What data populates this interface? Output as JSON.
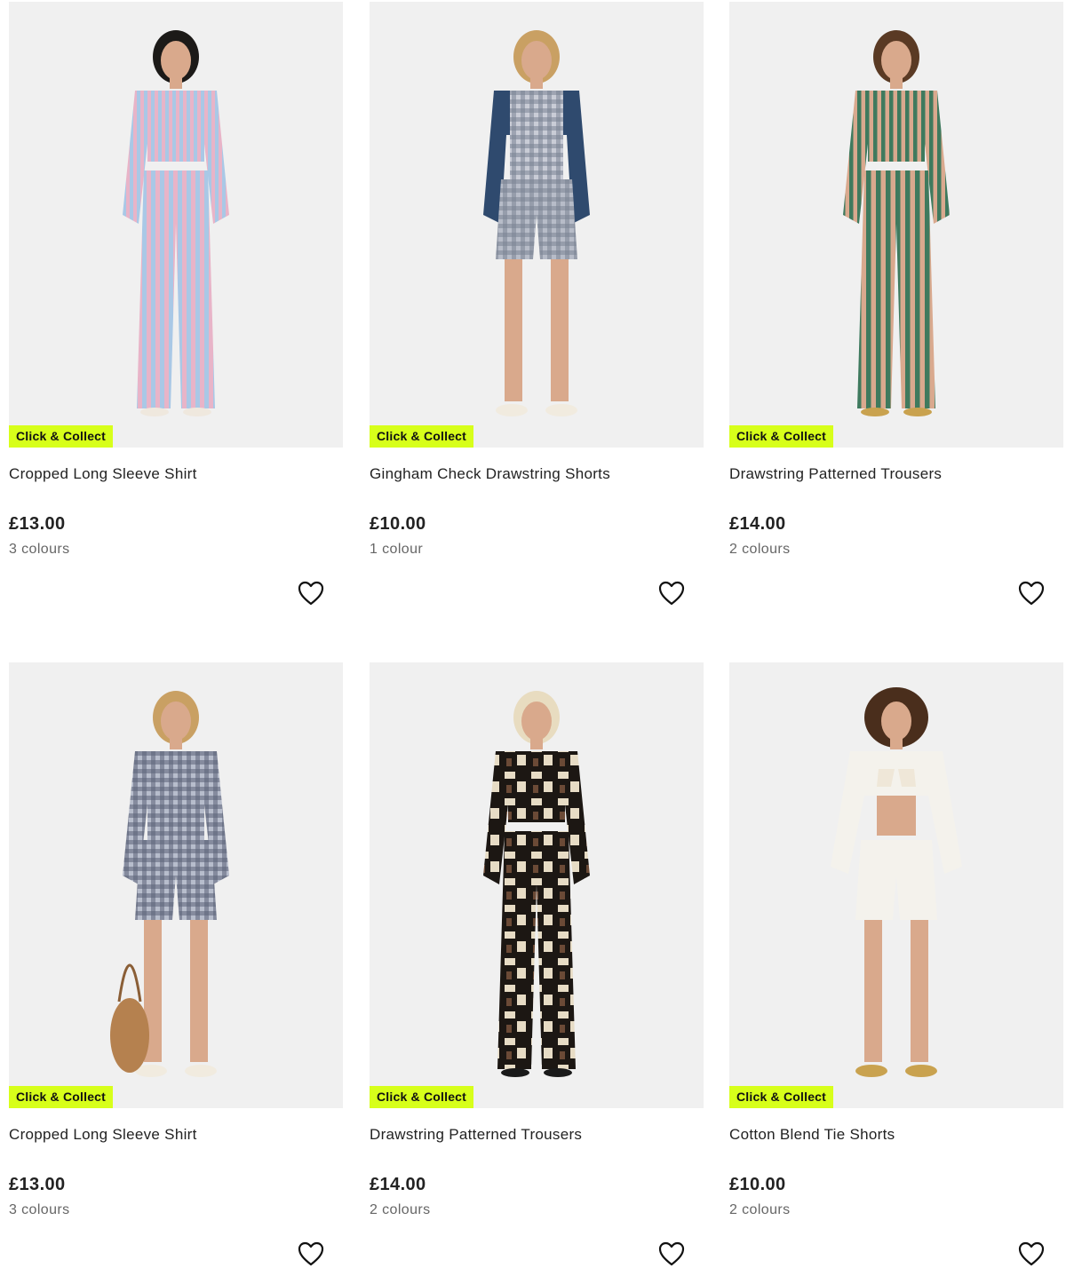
{
  "products": [
    {
      "badge": "Click & Collect",
      "name": "Cropped Long Sleeve Shirt",
      "price": "£13.00",
      "colours": "3 colours",
      "colors": {
        "top": "#e8b4c8",
        "top2": "#a9c8e6",
        "bottom": "#e8b4c8",
        "bottom2": "#a9c8e6",
        "hair": "#1c1a18",
        "shoes": "#efe8de"
      }
    },
    {
      "badge": "Click & Collect",
      "name": "Gingham Check Drawstring Shorts",
      "price": "£10.00",
      "colours": "1 colour",
      "colors": {
        "top": "#2f4a6e",
        "top2": "#c9ccd6",
        "bottom": "#b7bcc8",
        "bottom2": "#7a8294",
        "hair": "#c9a063",
        "shoes": "#f1ebdf"
      }
    },
    {
      "badge": "Click & Collect",
      "name": "Drawstring Patterned Trousers",
      "price": "£14.00",
      "colours": "2 colours",
      "colors": {
        "top": "#d9a98e",
        "top2": "#3f7a5e",
        "bottom": "#d9a98e",
        "bottom2": "#3f7a5e",
        "hair": "#5a3a24",
        "shoes": "#c9a24f"
      }
    },
    {
      "badge": "Click & Collect",
      "name": "Cropped Long Sleeve Shirt",
      "price": "£13.00",
      "colours": "3 colours",
      "colors": {
        "top": "#b7bdcc",
        "top2": "#5b6278",
        "bottom": "#b7bdcc",
        "bottom2": "#5b6278",
        "hair": "#c9a063",
        "shoes": "#f1ebdf"
      }
    },
    {
      "badge": "Click & Collect",
      "name": "Drawstring Patterned Trousers",
      "price": "£14.00",
      "colours": "2 colours",
      "colors": {
        "top": "#1c1713",
        "top2": "#e7dcc5",
        "bottom": "#1c1713",
        "bottom2": "#e7dcc5",
        "hair": "#e8dcc0",
        "shoes": "#1a1a1a"
      }
    },
    {
      "badge": "Click & Collect",
      "name": "Cotton Blend Tie Shorts",
      "price": "£10.00",
      "colours": "2 colours",
      "colors": {
        "top": "#f4f2ec",
        "top2": "#e9e5da",
        "bottom": "#f4f2ec",
        "bottom2": "#e4e0d4",
        "hair": "#4a2e1c",
        "shoes": "#c9a24f"
      }
    }
  ],
  "theme": {
    "badge_bg": "#d7ff1a",
    "image_bg": "#f0f0f0",
    "text": "#222222",
    "muted": "#666666"
  },
  "icons": {
    "wishlist": "heart-outline-icon"
  }
}
